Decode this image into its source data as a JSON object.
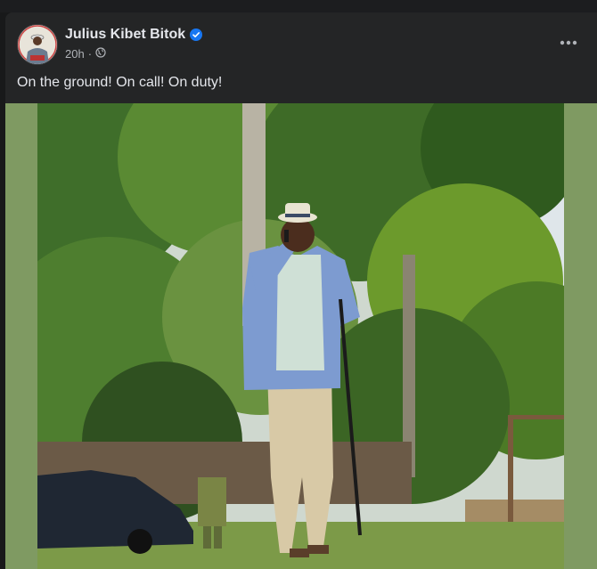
{
  "post": {
    "author": "Julius Kibet Bitok",
    "verified_icon": "verified-badge-icon",
    "time": "20h",
    "separator": "·",
    "audience_icon": "globe-icon",
    "more_icon": "more-options-icon",
    "caption": "On the ground! On call! On duty!"
  },
  "colors": {
    "card_bg": "#242526",
    "text_primary": "#e4e6eb",
    "text_secondary": "#b0b3b8",
    "verified_blue": "#1877f2",
    "media_border": "#7f9a62"
  }
}
